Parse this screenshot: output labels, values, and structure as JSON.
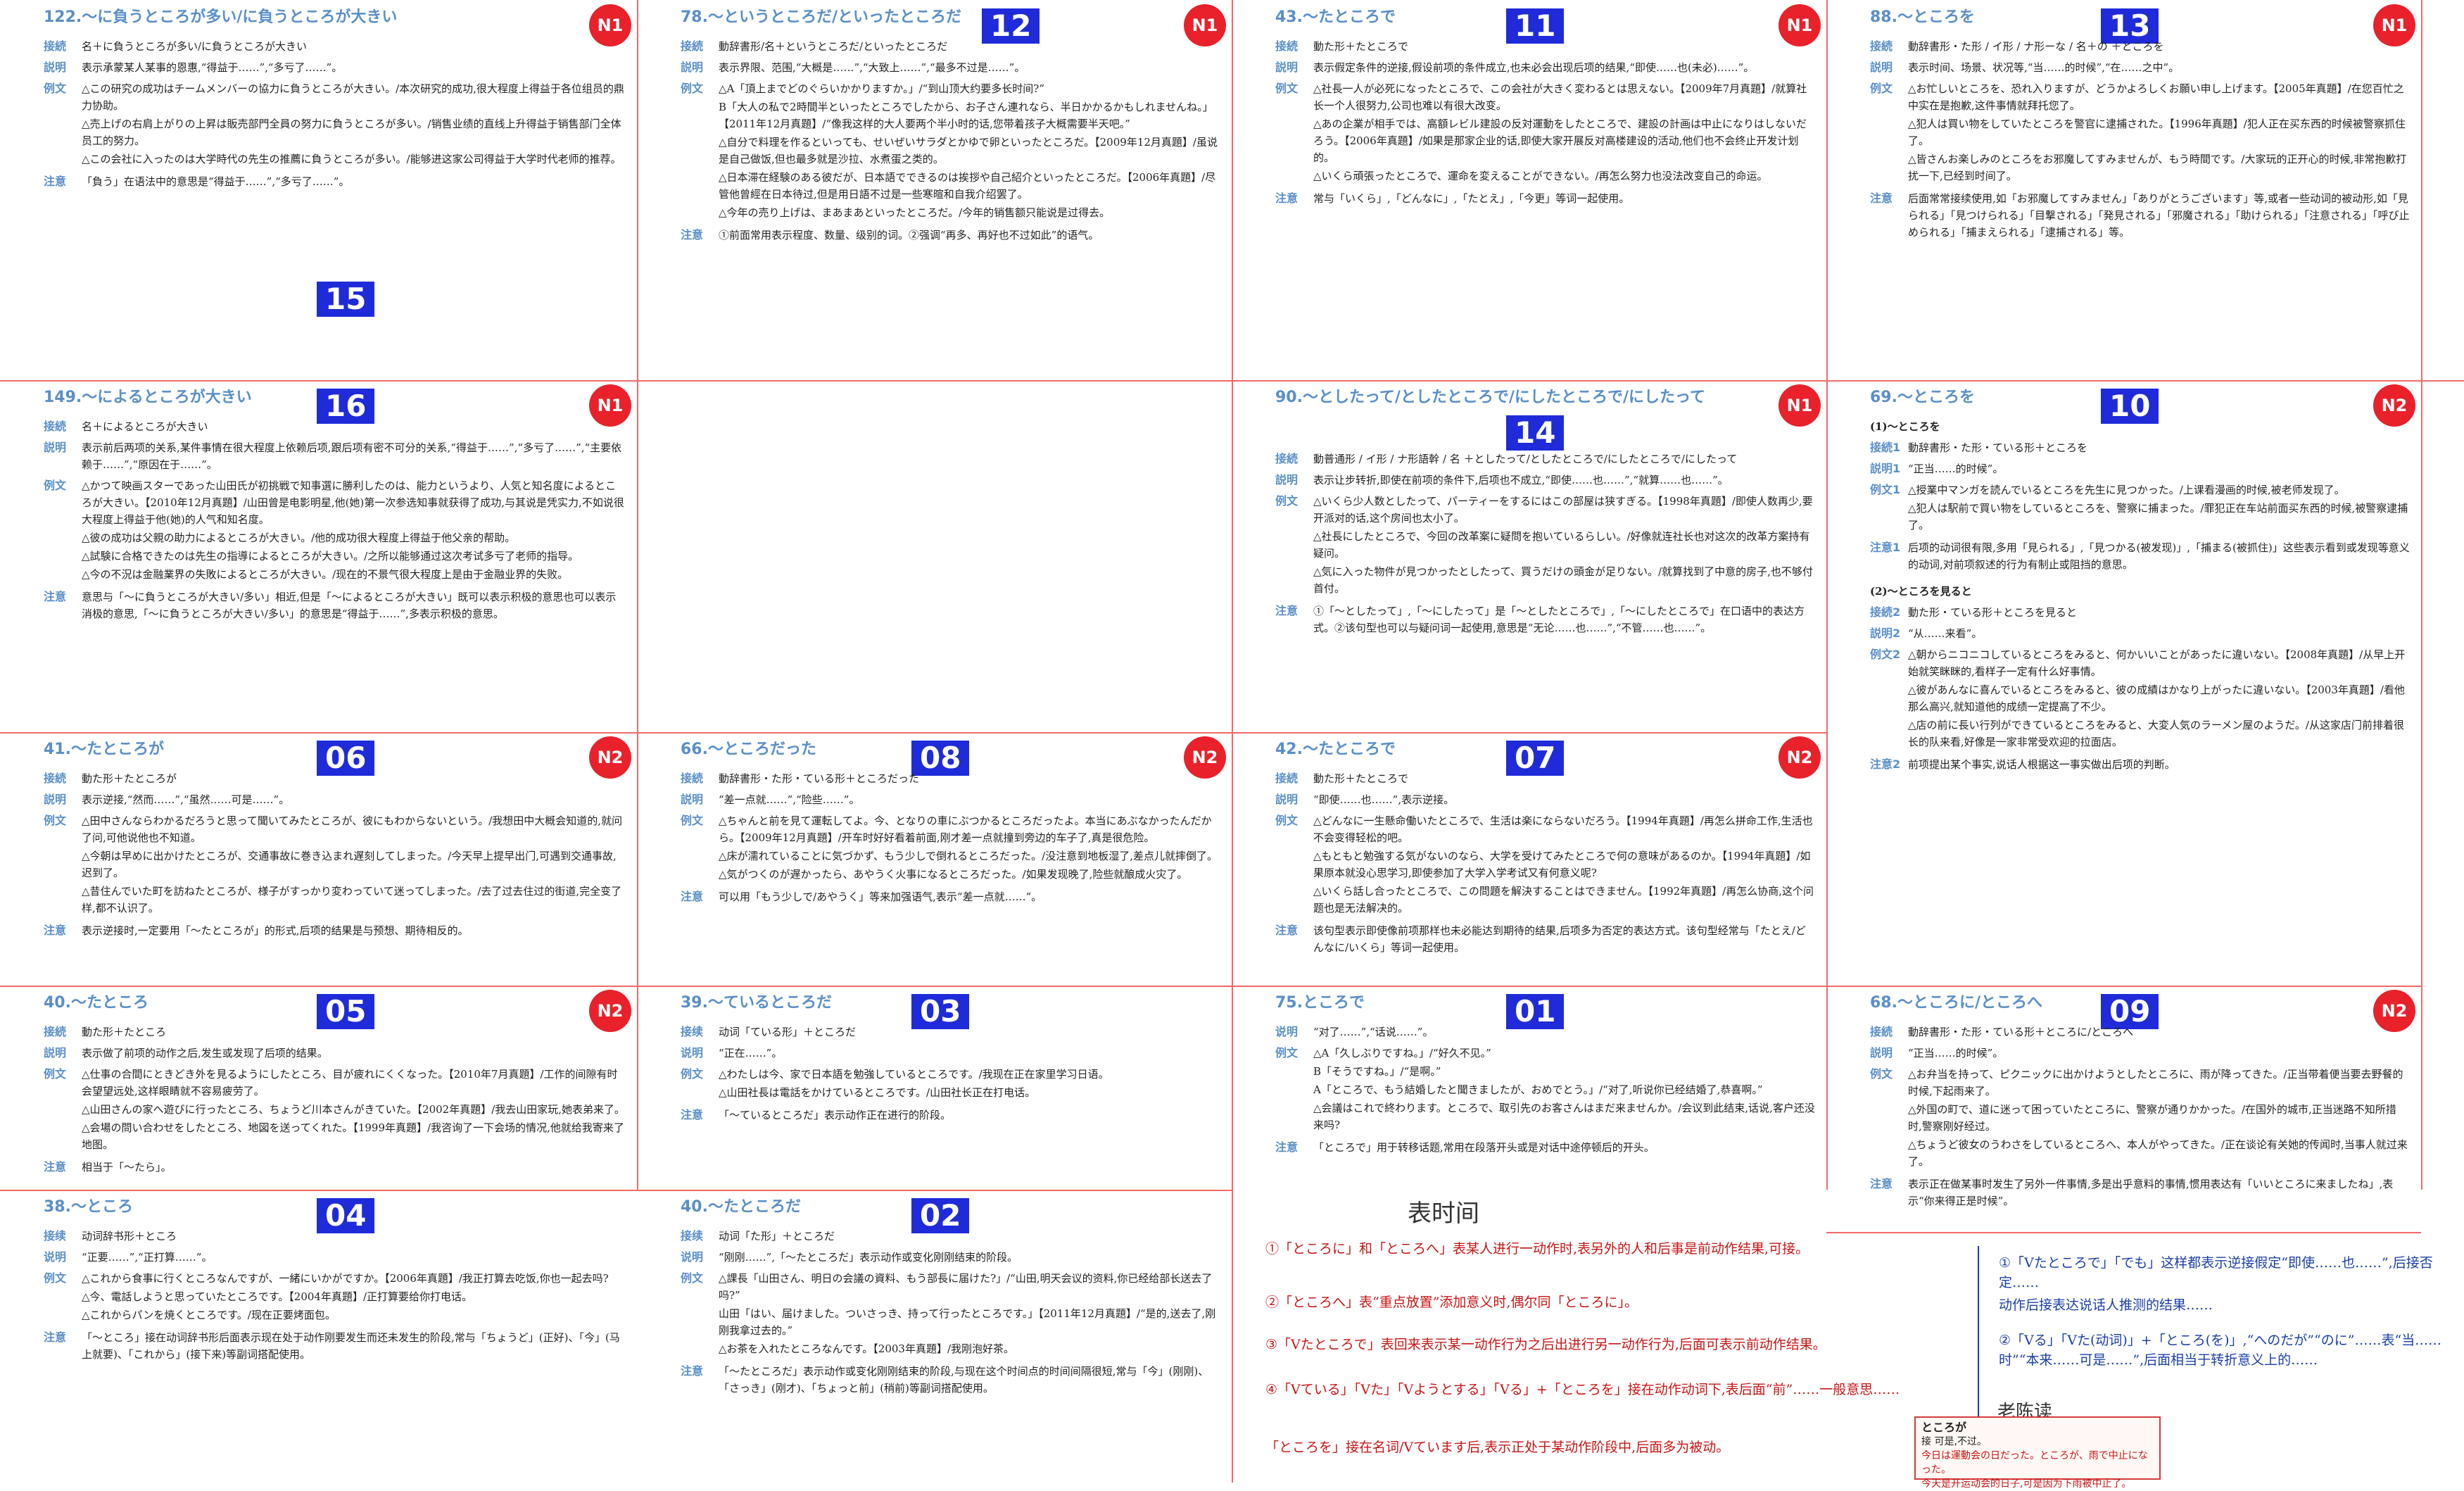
{
  "cells": {
    "c122": {
      "title": "122.～に負うところが多い/に負うところが大きい",
      "num": "15",
      "level": "N1",
      "labels": [
        "接続",
        "説明",
        "例文",
        "注意"
      ],
      "connect": "名＋に負うところが多い/に負うところが大きい",
      "explain": "表示承蒙某人某事的恩惠,“得益于……”,“多亏了……”。",
      "examples": [
        "△この研究の成功はチームメンバーの協力に負うところが大きい。/本次研究的成功,很大程度上得益于各位组员的鼎力协助。",
        "△売上げの右肩上がりの上昇は販売部門全員の努力に負うところが多い。/销售业绩的直线上升得益于销售部门全体员工的努力。",
        "△この会社に入ったのは大学時代の先生の推薦に負うところが多い。/能够进这家公司得益于大学时代老师的推荐。"
      ],
      "note": "「負う」在语法中的意思是“得益于……”,“多亏了……”。"
    },
    "c78": {
      "title": "78.～というところだ/といったところだ",
      "num": "12",
      "level": "N1",
      "labels": [
        "接続",
        "説明",
        "例文",
        "注意"
      ],
      "connect": "動辞書形/名＋というところだ/といったところだ",
      "explain": "表示界限、范围,“大概是……”,“大致上……”,“最多不过是……”。",
      "examples": [
        "△A「頂上までどのぐらいかかりますか。」/“到山顶大约要多长时间?”",
        "B「大人の私で2時間半といったところでしたから、お子さん連れなら、半日かかるかもしれませんね。」【2011年12月真題】/“像我这样的大人要两个半小时的话,您带着孩子大概需要半天吧。”",
        "△自分で料理を作るといっても、せいぜいサラダとかゆで卵といったところだ。【2009年12月真題】/虽说是自己做饭,但也最多就是沙拉、水煮蛋之类的。",
        "△日本滞在経験のある彼だが、日本語でできるのは挨拶や自己紹介といったところだ。【2006年真題】/尽管他曾經在日本待过,但是用日語不过是一些寒暄和自我介绍罢了。",
        "△今年の売り上げは、まあまあといったところだ。/今年的销售额只能说是过得去。"
      ],
      "note": "①前面常用表示程度、数量、级别的词。②强调“再多、再好也不过如此”的语气。"
    },
    "c43": {
      "title": "43.～たところで",
      "num": "11",
      "level": "N1",
      "labels": [
        "接続",
        "説明",
        "例文",
        "注意"
      ],
      "connect": "動た形＋たところで",
      "explain": "表示假定条件的逆接,假设前项的条件成立,也未必会出现后项的结果,“即使……也(未必)……”。",
      "examples": [
        "△社長一人が必死になったところで、この会社が大きく変わるとは思えない。【2009年7月真題】/就算社长一个人很努力,公司也难以有很大改变。",
        "△あの企業が相手では、高額レビル建設の反対運動をしたところで、建設の計画は中止になりはしないだろう。【2006年真題】/如果是那家企业的话,即使大家开展反对高楼建设的活动,他们也不会终止开发计划的。",
        "△いくら頑張ったところで、運命を変えることができない。/再怎么努力也没法改变自己的命运。"
      ],
      "note": "常与「いくら」,「どんなに」,「たとえ」,「今更」等词一起使用。"
    },
    "c88": {
      "title": "88.～ところを",
      "num": "13",
      "level": "N1",
      "labels": [
        "接続",
        "説明",
        "例文",
        "注意"
      ],
      "connect": "動辞書形・た形 / イ形 / ナ形ーな / 名＋の ＋ところを",
      "explain": "表示时间、场景、状况等,“当……的时候”,“在……之中”。",
      "examples": [
        "△お忙しいところを、恐れ入りますが、どうかよろしくお願い申し上げます。【2005年真題】/在您百忙之中实在是抱歉,这件事情就拜托您了。",
        "△犯人は買い物をしていたところを警官に逮捕された。【1996年真題】/犯人正在买东西的时候被警察抓住了。",
        "△皆さんお楽しみのところをお邪魔してすみませんが、もう時間です。/大家玩的正开心的时候,非常抱歉打扰一下,已经到时间了。"
      ],
      "note": "后面常常接续使用,如「お邪魔してすみません」「ありがとうございます」等,或者一些动词的被动形,如「見られる」「見つけられる」「目撃される」「発見される」「邪魔される」「助けられる」「注意される」「呼び止められる」「捕まえられる」「逮捕される」等。"
    },
    "c149": {
      "title": "149.～によるところが大きい",
      "num": "16",
      "level": "N1",
      "labels": [
        "接続",
        "説明",
        "例文",
        "注意"
      ],
      "connect": "名＋によるところが大きい",
      "explain": "表示前后两项的关系,某件事情在很大程度上依赖后项,跟后项有密不可分的关系,“得益于……”,“多亏了……”,“主要依赖于……”,“原因在于……”。",
      "examples": [
        "△かつて映画スターであった山田氏が初挑戦で知事選に勝利したのは、能力というより、人気と知名度によるところが大きい。【2010年12月真題】/山田曾是电影明星,他(她)第一次参选知事就获得了成功,与其说是凭实力,不如说很大程度上得益于他(她)的人气和知名度。",
        "△彼の成功は父親の助力によるところが大きい。/他的成功很大程度上得益于他父亲的帮助。",
        "△試験に合格できたのは先生の指導によるところが大きい。/之所以能够通过这次考试多亏了老师的指导。",
        "△今の不況は金融業界の失敗によるところが大きい。/现在的不景气很大程度上是由于金融业界的失败。"
      ],
      "note": "意思与「～に負うところが大きい/多い」相近,但是「～によるところが大きい」既可以表示积极的意思也可以表示消极的意思,「～に負うところが大きい/多い」的意思是“得益于……”,多表示积极的意思。"
    },
    "c90": {
      "title": "90.～としたって/としたところで/にしたところで/にしたって",
      "num": "14",
      "level": "N1",
      "labels": [
        "接続",
        "説明",
        "例文",
        "注意"
      ],
      "connect": "動普通形 / イ形 / ナ形語幹 / 名 ＋としたって/としたところで/にしたところで/にしたって",
      "explain": "表示让步转折,即使在前项的条件下,后项也不成立,“即使……也……”,“就算……也……”。",
      "examples": [
        "△いくら少人数としたって、パーティーをするにはこの部屋は狭すぎる。【1998年真題】/即使人数再少,要开派对的话,这个房间也太小了。",
        "△社長にしたところで、今回の改革案に疑問を抱いているらしい。/好像就连社长也对这次的改革方案持有疑问。",
        "△気に入った物件が見つかったとしたって、買うだけの頭金が足りない。/就算找到了中意的房子,也不够付首付。"
      ],
      "note": "①「～としたって」,「～にしたって」是「～としたところで」,「～にしたところで」在口语中的表达方式。②该句型也可以与疑问词一起使用,意思是“无论……也……”,“不管……也……”。"
    },
    "c69": {
      "title": "69.～ところを",
      "num": "10",
      "level": "N2",
      "labels": [
        "接続1",
        "説明1",
        "例文1",
        "注意1",
        "接続2",
        "説明2",
        "例文2",
        "注意2"
      ],
      "sub1": "(1)～ところを",
      "connect1": "動辞書形・た形・ている形＋ところを",
      "explain1": "“正当……的时候”。",
      "examples1": [
        "△授業中マンガを読んでいるところを先生に見つかった。/上课看漫画的时候,被老师发现了。",
        "△犯人は駅前で買い物をしているところを、警察に捕まった。/罪犯正在车站前面买东西的时候,被警察逮捕了。"
      ],
      "note1": "后项的动词很有限,多用「見られる」,「見つかる(被发现)」,「捕まる(被抓住)」这些表示看到或发现等意义的动词,对前项叙述的行为有制止或阻挡的意思。",
      "sub2": "(2)～ところを見ると",
      "connect2": "動た形・ている形＋ところを見ると",
      "explain2": "“从……来看”。",
      "examples2": [
        "△朝からニコニコしているところをみると、何かいいことがあったに違いない。【2008年真題】/从早上开始就笑眯眯的,看样子一定有什么好事情。",
        "△彼があんなに喜んでいるところをみると、彼の成績はかなり上がったに違いない。【2003年真題】/看他那么高兴,就知道他的成绩一定提高了不少。",
        "△店の前に長い行列ができているところをみると、大変人気のラーメン屋のようだ。/从这家店门前排着很长的队来看,好像是一家非常受欢迎的拉面店。"
      ],
      "note2": "前项提出某个事实,说话人根据这一事实做出后项的判断。"
    },
    "c41": {
      "title": "41.～たところが",
      "num": "06",
      "level": "N2",
      "labels": [
        "接続",
        "説明",
        "例文",
        "注意"
      ],
      "connect": "動た形＋たところが",
      "explain": "表示逆接,“然而……”,“虽然……可是……”。",
      "examples": [
        "△田中さんならわかるだろうと思って聞いてみたところが、彼にもわからないという。/我想田中大概会知道的,就问了问,可他说他也不知道。",
        "△今朝は早めに出かけたところが、交通事故に巻き込まれ遅刻してしまった。/今天早上提早出门,可遇到交通事故,迟到了。",
        "△昔住んでいた町を訪ねたところが、様子がすっかり変わっていて迷ってしまった。/去了过去住过的街道,完全变了样,都不认识了。"
      ],
      "note": "表示逆接时,一定要用「～たところが」的形式,后项的结果是与预想、期待相反的。"
    },
    "c66": {
      "title": "66.～ところだった",
      "num": "08",
      "level": "N2",
      "labels": [
        "接続",
        "説明",
        "例文",
        "注意"
      ],
      "connect": "動辞書形・た形・ている形＋ところだった",
      "explain": "“差一点就……”,“险些……”。",
      "examples": [
        "△ちゃんと前を見て運転してよ。今、となりの車にぶつかるところだったよ。本当にあぶなかったんだから。【2009年12月真題】/开车时好好看着前面,刚才差一点就撞到旁边的车子了,真是很危险。",
        "△床が濡れていることに気づかず、もう少しで倒れるところだった。/没注意到地板湿了,差点儿就摔倒了。",
        "△気がつくのが遅かったら、あやうく火事になるところだった。/如果发现晚了,险些就酿成火灾了。"
      ],
      "note": "可以用「もう少しで/あやうく」等来加强语气,表示“差一点就……”。"
    },
    "c42": {
      "title": "42.～たところで",
      "num": "07",
      "level": "N2",
      "labels": [
        "接続",
        "説明",
        "例文",
        "注意"
      ],
      "connect": "動た形＋たところで",
      "explain": "“即使……也……”,表示逆接。",
      "examples": [
        "△どんなに一生懸命働いたところで、生活は楽にならないだろう。【1994年真題】/再怎么拼命工作,生活也不会变得轻松的吧。",
        "△もともと勉強する気がないのなら、大学を受けてみたところで何の意味があるのか。【1994年真題】/如果原本就没心思学习,即使参加了大学入学考试又有何意义呢?",
        "△いくら話し合ったところで、この問題を解決することはできません。【1992年真題】/再怎么协商,这个问题也是无法解决的。"
      ],
      "note": "该句型表示即使像前项那样也未必能达到期待的结果,后项多为否定的表达方式。该句型经常与「たとえ/どんなに/いくら」等词一起使用。"
    },
    "c40a": {
      "title": "40.～たところ",
      "num": "05",
      "level": "N2",
      "labels": [
        "接続",
        "説明",
        "例文",
        "注意"
      ],
      "connect": "動た形＋たところ",
      "explain": "表示做了前项的动作之后,发生或发现了后项的结果。",
      "examples": [
        "△仕事の合間にときどき外を見るようにしたところ、目が疲れにくくなった。【2010年7月真題】/工作的间隙有时会望望远处,这样眼睛就不容易疲劳了。",
        "△山田さんの家へ遊びに行ったところ、ちょうど川本さんがきていた。【2002年真題】/我去山田家玩,她表弟来了。",
        "△会場の問い合わせをしたところ、地図を送ってくれた。【1999年真題】/我咨询了一下会场的情况,他就给我寄来了地图。"
      ],
      "note": "相当于「～たら」。"
    },
    "c39": {
      "title": "39.～ているところだ",
      "num": "03",
      "level": "",
      "labels": [
        "接续",
        "说明",
        "例文",
        "注意"
      ],
      "connect": "动词「ている形」＋ところだ",
      "explain": "“正在……”。",
      "examples": [
        "△わたしは今、家で日本語を勉強しているところです。/我现在正在家里学习日语。",
        "△山田社長は電話をかけているところです。/山田社长正在打电话。"
      ],
      "note": "「～ているところだ」表示动作正在进行的阶段。"
    },
    "c75": {
      "title": "75.ところで",
      "num": "01",
      "level": "",
      "labels": [
        "说明",
        "例文",
        "注意"
      ],
      "explain": "“对了……”,“话说……”。",
      "examples": [
        "△A「久しぶりですね。」/“好久不见。”",
        "B「そうですね。」/“是啊。”",
        "A「ところで、もう結婚したと聞きましたが、おめでとう。」/“对了,听说你已经结婚了,恭喜啊。”",
        "△会議はこれで終わります。ところで、取引先のお客さんはまだ来ませんか。/会议到此结束,话说,客户还没来吗?"
      ],
      "note": "「ところで」用于转移话题,常用在段落开头或是对话中途停顿后的开头。"
    },
    "c68": {
      "title": "68.～ところに/ところへ",
      "num": "09",
      "level": "N2",
      "labels": [
        "接続",
        "説明",
        "例文",
        "注意"
      ],
      "connect": "動辞書形・た形・ている形＋ところに/ところへ",
      "explain": "“正当……的时候”。",
      "examples": [
        "△お弁当を持って、ピクニックに出かけようとしたところに、雨が降ってきた。/正当带着便当要去野餐的时候,下起雨来了。",
        "△外国の町で、道に迷って困っていたところに、警察が通りかかった。/在国外的城市,正当迷路不知所措时,警察刚好经过。",
        "△ちょうど彼女のうわさをしているところへ、本人がやってきた。/正在谈论有关她的传闻时,当事人就过来了。"
      ],
      "note": "表示正在做某事时发生了另外一件事情,多是出乎意料的事情,惯用表达有「いいところに来ましたね」,表示“你来得正是时候”。"
    },
    "c38": {
      "title": "38.～ところ",
      "num": "04",
      "level": "",
      "labels": [
        "接续",
        "说明",
        "例文",
        "注意"
      ],
      "connect": "动词辞书形＋ところ",
      "explain": "“正要……”,“正打算……”。",
      "examples": [
        "△これから食事に行くところなんですが、一緒にいかがですか。【2006年真題】/我正打算去吃饭,你也一起去吗?",
        "△今、電話しようと思っていたところです。【2004年真題】/正打算要给你打电话。",
        "△これからパンを焼くところです。/现在正要烤面包。"
      ],
      "note": "「～ところ」接在动词辞书形后面表示现在处于动作刚要发生而还未发生的阶段,常与「ちょうど」(正好)、「今」(马上就要)、「これから」(接下来)等副词搭配使用。"
    },
    "c40b": {
      "title": "40.～たところだ",
      "num": "02",
      "level": "",
      "labels": [
        "接续",
        "说明",
        "例文",
        "注意"
      ],
      "connect": "动词「た形」＋ところだ",
      "explain": "“刚刚……”,「～たところだ」表示动作或变化刚刚结束的阶段。",
      "examples": [
        "△課長「山田さん、明日の会議の資料、もう部長に届けた?」/“山田,明天会议的资料,你已经给部长送去了吗?”",
        "山田「はい、届けました。ついさっき、持って行ったところです。」【2011年12月真題】/“是的,送去了,刚刚我拿过去的。”",
        "△お茶を入れたところなんです。【2003年真題】/我刚泡好茶。"
      ],
      "note": "「～たところだ」表示动作或变化刚刚结束的阶段,与现在这个时间点的时间间隔很短,常与「今」(刚刚)、「さっき」(刚才)、「ちょっと前」(稍前)等副词搭配使用。"
    }
  },
  "memo": {
    "title": "表时间",
    "notes_red": [
      "①「ところに」和「ところへ」表某人进行一动作时,表另外的人和后事是前动作结果,可接。",
      "②「ところへ」表“重点放置”添加意义时,偶尔同「ところに」。",
      "③「Vたところで」表回来表示某一动作行为之后出进行另一动作行为,后面可表示前动作结果。",
      "④「Vている」「Vた」「Vようとする」「Vる」+「ところを」接在动作动词下,表后面“前”……一般意思……",
      "「ところを」接在名词/Vています后,表示正处于某动作阶段中,后面多为被动。"
    ],
    "notes_blue": [
      "①「Vたところで」「でも」这样都表示逆接假定“即使……也……”,后接否定……",
      "动作后接表达说话人推测的结果……",
      "②「Vる」「Vた(动词)」+「ところ(を)」,“へのだが”“のに”……表“当……时”“本来……可是……”,后面相当于转折意义上的……"
    ],
    "signature": "老陈读",
    "box": {
      "title": "ところが",
      "line1": "接  可是,不过。",
      "line2": "今日は運動会の日だった。ところが、雨で中止になった。",
      "line3": "今天是开运动会的日子,可是因为下雨被中止了。"
    }
  }
}
